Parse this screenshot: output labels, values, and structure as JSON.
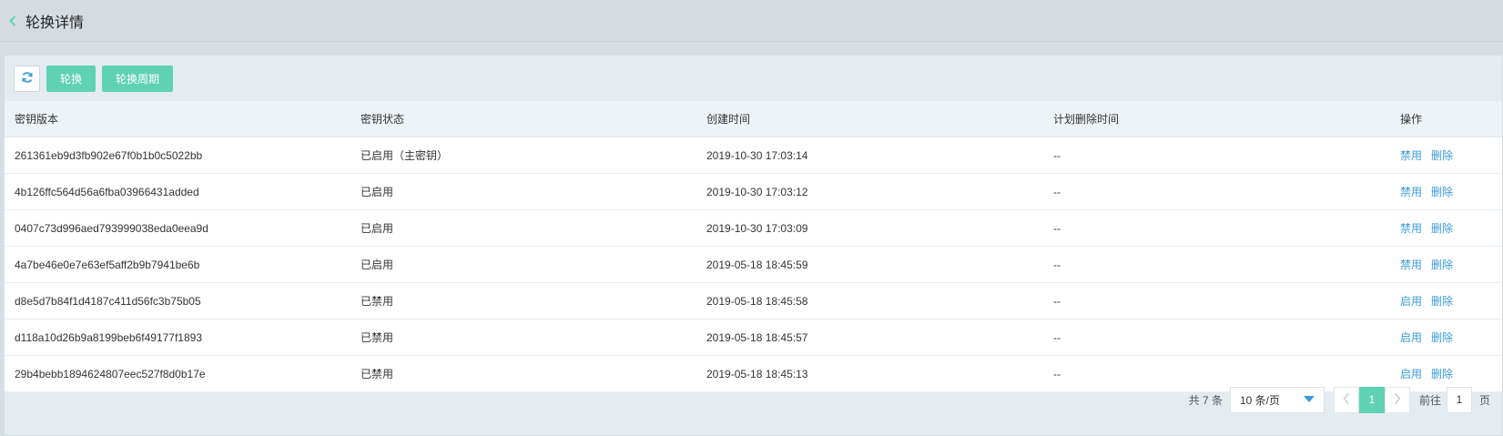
{
  "header": {
    "title": "轮换详情",
    "back_icon": "chevron-left-icon",
    "accent": "#5fd2b3"
  },
  "toolbar": {
    "refresh_icon": "refresh-icon",
    "rotate_label": "轮换",
    "period_label": "轮换周期"
  },
  "table": {
    "columns": [
      "密钥版本",
      "密钥状态",
      "创建时间",
      "计划删除时间",
      "操作"
    ],
    "rows": [
      {
        "version": "261361eb9d3fb902e67f0b1b0c5022bb",
        "status": "已启用（主密钥）",
        "created": "2019-10-30 17:03:14",
        "delete_at": "--",
        "action": "禁用",
        "delete": "删除"
      },
      {
        "version": "4b126ffc564d56a6fba03966431added",
        "status": "已启用",
        "created": "2019-10-30 17:03:12",
        "delete_at": "--",
        "action": "禁用",
        "delete": "删除"
      },
      {
        "version": "0407c73d996aed793999038eda0eea9d",
        "status": "已启用",
        "created": "2019-10-30 17:03:09",
        "delete_at": "--",
        "action": "禁用",
        "delete": "删除"
      },
      {
        "version": "4a7be46e0e7e63ef5aff2b9b7941be6b",
        "status": "已启用",
        "created": "2019-05-18 18:45:59",
        "delete_at": "--",
        "action": "禁用",
        "delete": "删除"
      },
      {
        "version": "d8e5d7b84f1d4187c411d56fc3b75b05",
        "status": "已禁用",
        "created": "2019-05-18 18:45:58",
        "delete_at": "--",
        "action": "启用",
        "delete": "删除"
      },
      {
        "version": "d118a10d26b9a8199beb6f49177f1893",
        "status": "已禁用",
        "created": "2019-05-18 18:45:57",
        "delete_at": "--",
        "action": "启用",
        "delete": "删除"
      },
      {
        "version": "29b4bebb1894624807eec527f8d0b17e",
        "status": "已禁用",
        "created": "2019-05-18 18:45:13",
        "delete_at": "--",
        "action": "启用",
        "delete": "删除"
      }
    ]
  },
  "pagination": {
    "total": "共 7 条",
    "page_size": "10 条/页",
    "current_page": "1",
    "goto_label": "前往",
    "goto_value": "1",
    "page_suffix": "页"
  }
}
